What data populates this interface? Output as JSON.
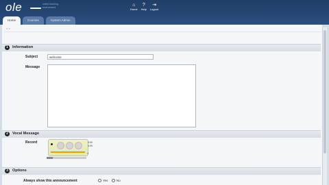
{
  "header": {
    "logo": "ole",
    "tagline": "online learning environment",
    "nav": [
      {
        "label": "Home",
        "icon": "home-icon"
      },
      {
        "label": "Help",
        "icon": "help-icon"
      },
      {
        "label": "Logout",
        "icon": "logout-icon"
      }
    ]
  },
  "tabs": [
    {
      "label": "Home"
    },
    {
      "label": "Courses"
    },
    {
      "label": "System Admin"
    }
  ],
  "breadcrumb": "» »",
  "sections": [
    {
      "number": "1",
      "title": "Information"
    },
    {
      "number": "2",
      "title": "Vocal Message"
    },
    {
      "number": "3",
      "title": "Options"
    }
  ],
  "form": {
    "subject_label": "Subject",
    "subject_value": "welcome",
    "message_label": "Message",
    "message_value": "",
    "record_label": "Record",
    "recorder": {
      "time_elapsed": "0:00",
      "time_total": "0:00",
      "level": 0.15
    },
    "always_show_label": "Always show this announcement",
    "yes_label": "Yes",
    "no_label": "No"
  },
  "colors": {
    "header": "#1f3d66",
    "tab": "#5b7aa6",
    "progress": "#e3a400"
  }
}
